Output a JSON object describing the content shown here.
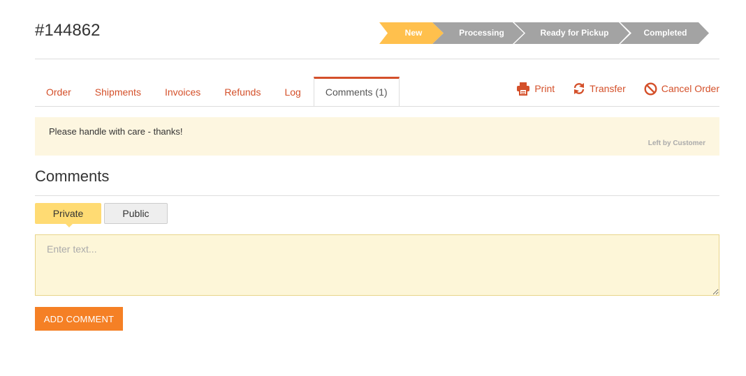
{
  "order": {
    "number": "#144862"
  },
  "status_steps": [
    {
      "label": "New",
      "state": "current",
      "color": "#ffc04d"
    },
    {
      "label": "Processing",
      "state": "pending",
      "color": "#a3a3a3"
    },
    {
      "label": "Ready for Pickup",
      "state": "pending",
      "color": "#a3a3a3"
    },
    {
      "label": "Completed",
      "state": "pending",
      "color": "#a3a3a3"
    }
  ],
  "tabs": [
    {
      "label": "Order"
    },
    {
      "label": "Shipments"
    },
    {
      "label": "Invoices"
    },
    {
      "label": "Refunds"
    },
    {
      "label": "Log"
    },
    {
      "label": "Comments (1)",
      "active": true
    }
  ],
  "actions": {
    "print": {
      "label": "Print",
      "icon": "printer-icon"
    },
    "transfer": {
      "label": "Transfer",
      "icon": "transfer-icon"
    },
    "cancel": {
      "label": "Cancel Order",
      "icon": "ban-icon"
    }
  },
  "customer_note": {
    "text": "Please handle with care - thanks!",
    "meta": "Left by Customer"
  },
  "comments": {
    "heading": "Comments",
    "visibility": {
      "private_label": "Private",
      "public_label": "Public",
      "selected": "Private"
    },
    "input_placeholder": "Enter text...",
    "input_value": "",
    "submit_label": "ADD COMMENT"
  },
  "colors": {
    "accent": "#d4502a",
    "button": "#f58025",
    "step_active": "#ffc04d",
    "step_inactive": "#a3a3a3",
    "note_bg": "#fdf6e0"
  }
}
